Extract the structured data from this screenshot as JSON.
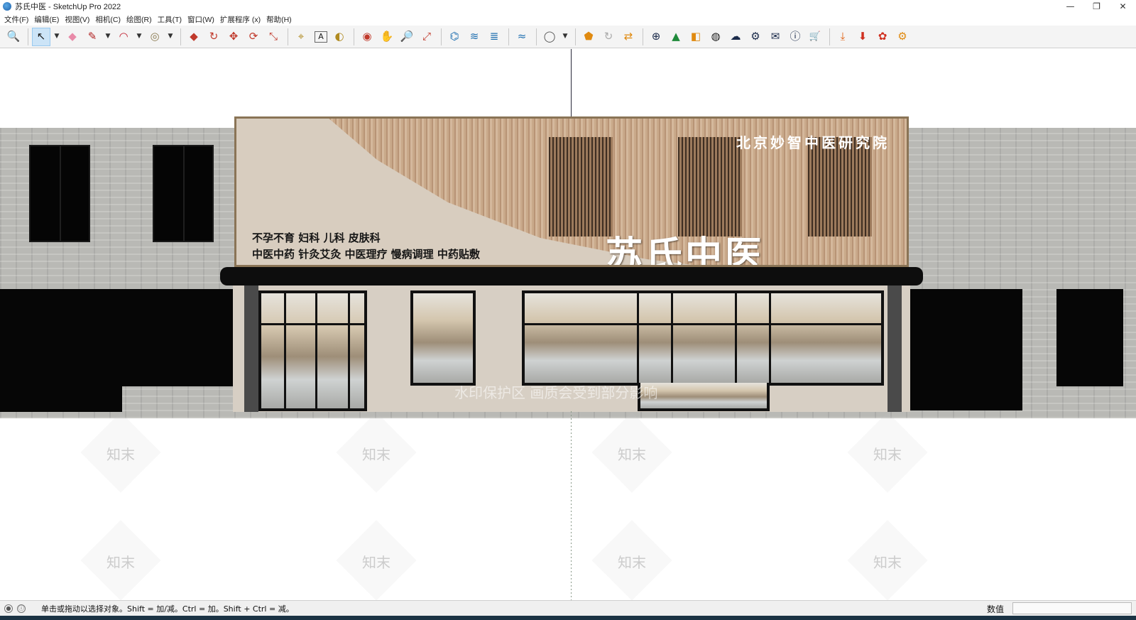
{
  "window": {
    "title": "苏氏中医 - SketchUp Pro 2022",
    "controls": {
      "minimize": "—",
      "restore": "❐",
      "close": "✕"
    }
  },
  "menu": [
    "文件(F)",
    "编辑(E)",
    "视图(V)",
    "相机(C)",
    "绘图(R)",
    "工具(T)",
    "窗口(W)",
    "扩展程序 (x)",
    "帮助(H)"
  ],
  "toolbar": {
    "icons": {
      "zoom-extents": "🔍",
      "select": "↖",
      "eraser": "◆",
      "pencil": "✎",
      "arc": "◠",
      "shape": "◎",
      "push-pull": "◆",
      "follow-me": "↻",
      "move": "✥",
      "rotate": "⟳",
      "scale": "⤡",
      "tape": "⌖",
      "text": "A",
      "paint": "◐",
      "orbit": "◉",
      "pan": "✋",
      "zoom": "🔎",
      "zoom-window": "⤢",
      "tag": "⌬",
      "layers": "≋",
      "sections": "≣",
      "styles": "≈",
      "account": "◯",
      "warehouse": "⬟",
      "sync": "↻",
      "share": "⇄",
      "add": "⊕",
      "tree": "▲",
      "photo": "◧",
      "pattern": "◍",
      "cloud": "☁",
      "gear": "⚙",
      "mail": "✉",
      "info": "ⓘ",
      "cart": "🛒",
      "download": "⤓",
      "install": "⬇",
      "ext-manager": "✿",
      "ext-settings": "⚙"
    },
    "dropdown": "▼"
  },
  "scene": {
    "sign_subtitle": "北京妙智中医研究院",
    "sign_line1": "不孕不育 妇科 儿科 皮肤科",
    "sign_line2": "中医中药 针灸艾灸 中医理疗 慢病调理 中药贴敷",
    "sign_title": "苏氏中医",
    "watermark_notice": "水印保护区   画质会受到部分影响",
    "watermark_brand": "知末",
    "colors": {
      "wall": "#b9b9b5",
      "sign_wood": "#c9a98a",
      "canopy": "#0d0d0d"
    }
  },
  "status": {
    "hint": "单击或拖动以选择对象。Shift = 加/减。Ctrl = 加。Shift + Ctrl = 减。",
    "measure_label": "数值",
    "measure_value": ""
  }
}
